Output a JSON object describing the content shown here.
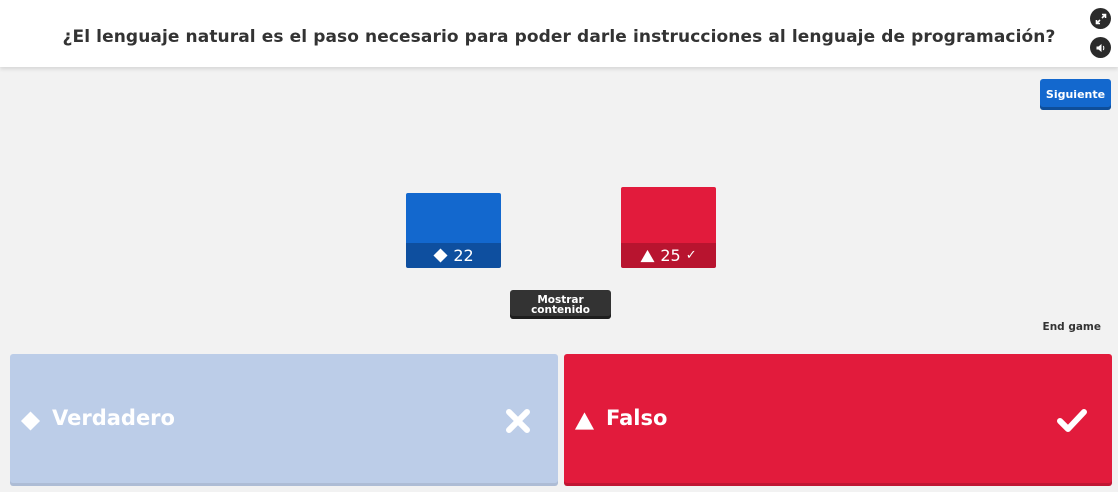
{
  "question": {
    "text": "¿El lenguaje natural es el paso necesario para poder darle instrucciones al lenguaje de programación?"
  },
  "controls": {
    "fullscreen_icon": "expand-icon",
    "sound_icon": "speaker-icon",
    "next_label": "Siguiente",
    "show_content_label": "Mostrar contenido",
    "end_game_label": "End game"
  },
  "results": [
    {
      "shape": "diamond",
      "count": "22",
      "color": "#1368ce",
      "correct": false
    },
    {
      "shape": "triangle",
      "count": "25",
      "color": "#e21b3c",
      "correct": true,
      "check": "✓"
    }
  ],
  "answers": [
    {
      "label": "Verdadero",
      "shape": "diamond",
      "mark_icon": "cross-icon",
      "color": "#bccde8",
      "correct": false
    },
    {
      "label": "Falso",
      "shape": "triangle",
      "mark_icon": "check-icon",
      "color": "#e21b3c",
      "correct": true
    }
  ]
}
